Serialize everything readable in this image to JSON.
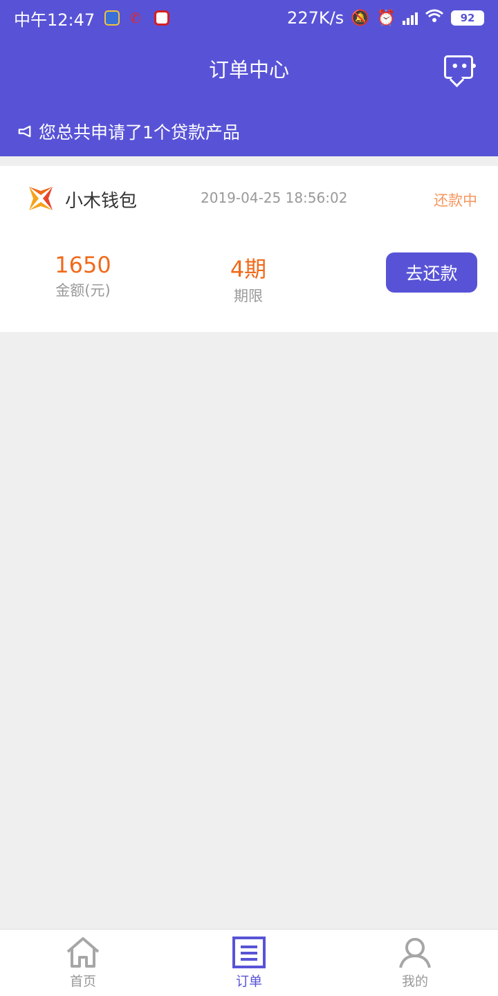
{
  "status_bar": {
    "time": "中午12:47",
    "net_speed": "227K/s",
    "battery": "92"
  },
  "header": {
    "title": "订单中心",
    "notice": "您总共申请了1个贷款产品",
    "message_icon": "message-dots-icon"
  },
  "order": {
    "name": "小木钱包",
    "date": "2019-04-25 18:56:02",
    "status": "还款中",
    "amount": "1650",
    "amount_label": "金额(元)",
    "term": "4期",
    "term_label": "期限",
    "action_label": "去还款"
  },
  "tabs": [
    {
      "label": "首页",
      "icon": "home-icon"
    },
    {
      "label": "订单",
      "icon": "order-icon"
    },
    {
      "label": "我的",
      "icon": "user-icon"
    }
  ],
  "colors": {
    "primary": "#5853d6",
    "accent_value": "#f06a1a",
    "status": "#f7965d",
    "background": "#efefef"
  }
}
